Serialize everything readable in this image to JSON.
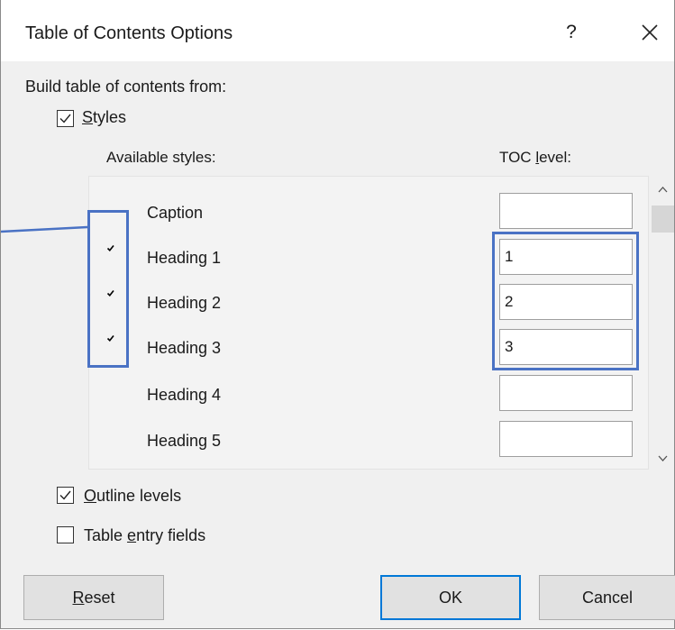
{
  "dialog": {
    "title": "Table of Contents Options",
    "help_label": "?",
    "close_icon": "close-icon"
  },
  "build_label": "Build table of contents from:",
  "styles_option": {
    "checked": true,
    "label_underlined": "S",
    "label_rest": "tyles"
  },
  "columns": {
    "available": "Available styles:",
    "toc_level_pre": "TOC ",
    "toc_level_underlined": "l",
    "toc_level_post": "evel:"
  },
  "styles": [
    {
      "name": "Caption",
      "in_use": false,
      "level": ""
    },
    {
      "name": "Heading 1",
      "in_use": true,
      "level": "1"
    },
    {
      "name": "Heading 2",
      "in_use": true,
      "level": "2"
    },
    {
      "name": "Heading 3",
      "in_use": true,
      "level": "3"
    },
    {
      "name": "Heading 4",
      "in_use": false,
      "level": ""
    },
    {
      "name": "Heading 5",
      "in_use": false,
      "level": ""
    }
  ],
  "outline_option": {
    "checked": true,
    "label_underlined": "O",
    "label_rest": "utline levels"
  },
  "table_entry_option": {
    "checked": false,
    "label_pre": "Table ",
    "label_underlined": "e",
    "label_rest": "ntry fields"
  },
  "buttons": {
    "reset_underlined": "R",
    "reset_rest": "eset",
    "ok": "OK",
    "cancel": "Cancel"
  },
  "colors": {
    "highlight": "#4a72c4",
    "ok_border": "#0078d7"
  }
}
